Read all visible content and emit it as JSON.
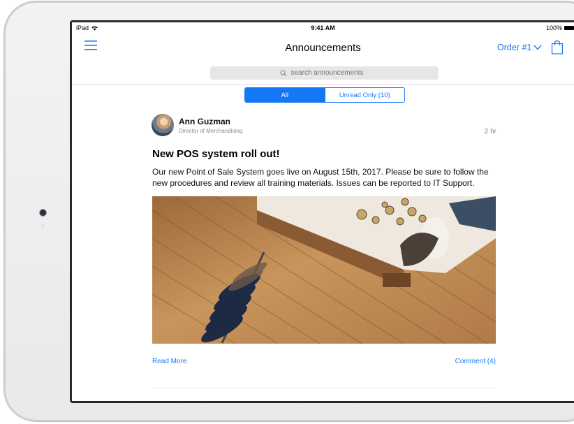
{
  "status_bar": {
    "carrier": "iPad",
    "time": "9:41 AM",
    "battery": "100%"
  },
  "nav": {
    "title": "Announcements",
    "order_label": "Order #1"
  },
  "search": {
    "placeholder": "search announcements"
  },
  "segments": {
    "all": "All",
    "unread": "Unread Only (10)"
  },
  "post": {
    "author": "Ann Guzman",
    "role": "Director of Merchandising",
    "time": "2 hr",
    "title": "New POS system roll out!",
    "body": "Our new Point of Sale System goes live on August 15th, 2017.  Please be sure to follow the new procedures and review all training materials.  Issues can be reported to IT Support."
  },
  "actions": {
    "read_more": "Read More",
    "comments": "Comment (4)"
  },
  "colors": {
    "accent": "#1478f5",
    "search_bg": "#e6e6e8",
    "text": "#111111"
  },
  "icons": [
    "wifi-icon",
    "battery-icon",
    "hamburger-menu-icon",
    "chevron-down-icon",
    "shopping-bag-icon",
    "magnifier-icon"
  ]
}
